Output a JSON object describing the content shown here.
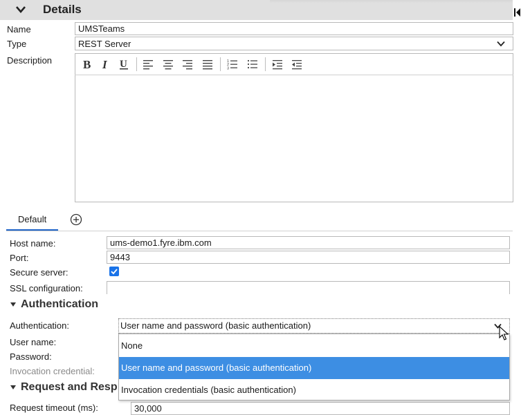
{
  "details": {
    "title": "Details"
  },
  "form": {
    "name_label": "Name",
    "name_value": "UMSTeams",
    "type_label": "Type",
    "type_value": "REST Server",
    "description_label": "Description"
  },
  "editor_toolbar": [
    "bold-icon",
    "italic-icon",
    "underline-icon",
    "align-left-icon",
    "align-center-icon",
    "align-right-icon",
    "justify-icon",
    "numbered-list-icon",
    "bulleted-list-icon",
    "indent-icon",
    "outdent-icon"
  ],
  "tabs": [
    {
      "label": "Default"
    }
  ],
  "server": {
    "host_label": "Host name:",
    "host_value": "ums-demo1.fyre.ibm.com",
    "port_label": "Port:",
    "port_value": "9443",
    "secure_label": "Secure server:",
    "secure_checked": true,
    "ssl_label": "SSL configuration:",
    "ssl_value": ""
  },
  "authentication": {
    "section_title": "Authentication",
    "auth_label": "Authentication:",
    "auth_value": "User name and password (basic authentication)",
    "username_label": "User name:",
    "password_label": "Password:",
    "invocation_label": "Invocation credential:",
    "options": [
      {
        "label": "None",
        "selected": false
      },
      {
        "label": "User name and password (basic authentication)",
        "selected": true
      },
      {
        "label": "Invocation credentials (basic authentication)",
        "selected": false
      }
    ]
  },
  "request": {
    "section_title": "Request and Resp",
    "timeout_label": "Request timeout (ms):",
    "timeout_value": "30,000"
  },
  "colors": {
    "accent": "#1e64c8",
    "selected_option": "#3d8ee3",
    "checkbox": "#1a73e8",
    "header_bg": "#e0e0e0"
  }
}
